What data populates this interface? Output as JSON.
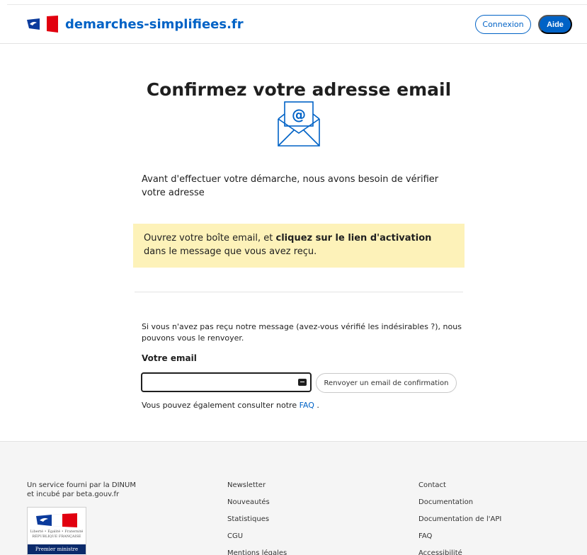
{
  "header": {
    "brand": "demarches-simplifiees.fr",
    "connexion_label": "Connexion",
    "aide_label": "Aide",
    "colors": {
      "brand_blue": "#0062c6",
      "flag_red": "#e1000f"
    }
  },
  "main": {
    "title": "Confirmez votre adresse email",
    "intro": "Avant d'effectuer votre démarche, nous avons besoin de vérifier votre adresse",
    "notice": {
      "before": "Ouvrez votre boîte email, et ",
      "bold": "cliquez sur le lien d'activation",
      "after": " dans le message que vous avez reçu.",
      "background": "#fdf2b9"
    },
    "resend_text": "Si vous n'avez pas reçu notre message (avez-vous vérifié les indésirables ?), nous pouvons vous le renvoyer.",
    "email_label": "Votre email",
    "email_value": "",
    "resend_button": "Renvoyer un email de confirmation",
    "faq_before": "Vous pouvez également consulter notre ",
    "faq_link": "FAQ",
    "faq_after": " ."
  },
  "footer": {
    "service_line1": "Un service fourni par la DINUM",
    "service_line2": "et incubé par beta.gouv.fr",
    "logo_motto_line1": "Liberté • Égalité • Fraternité",
    "logo_motto_line2": "RÉPUBLIQUE FRANÇAISE",
    "logo_pm": "Premier ministre",
    "col1": [
      "Newsletter",
      "Nouveautés",
      "Statistiques",
      "CGU",
      "Mentions légales"
    ],
    "col2": [
      "Contact",
      "Documentation",
      "Documentation de l'API",
      "FAQ",
      "Accessibilité"
    ]
  }
}
